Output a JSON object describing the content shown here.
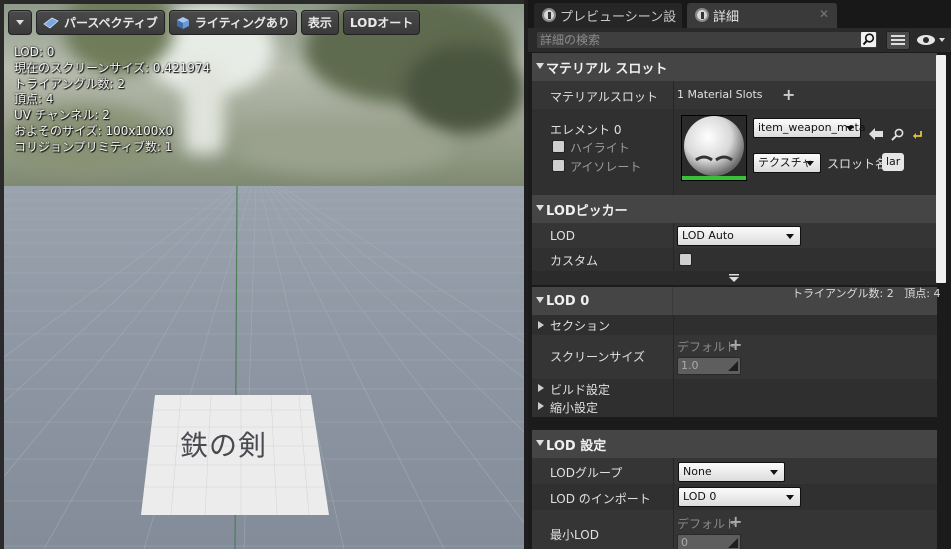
{
  "viewport": {
    "toolbar": {
      "perspective_label": "パースペクティブ",
      "lighting_label": "ライティングあり",
      "show_label": "表示",
      "lod_label": "LODオート"
    },
    "stats": [
      "LOD: 0",
      "現在のスクリーンサイズ: 0.421974",
      "トライアングル数: 2",
      "頂点: 4",
      "UV チャンネル: 2",
      "およそのサイズ: 100x100x0",
      "コリジョンプリミティブ数: 1"
    ],
    "card_text": "鉄の剣"
  },
  "details": {
    "tabs": [
      {
        "label": "プレビューシーン設"
      },
      {
        "label": "詳細"
      }
    ],
    "search_placeholder": "詳細の検索",
    "material_slots": {
      "title": "マテリアル スロット",
      "slots_label": "マテリアルスロット",
      "slots_value": "1 Material Slots",
      "element_label": "エレメント 0",
      "highlight_label": "ハイライト",
      "isolate_label": "アイソレート",
      "material_name": "item_weapon_meta",
      "texture_label": "テクスチャ",
      "slot_name_label": "スロット名",
      "slot_name_value": "lar"
    },
    "lod_picker": {
      "title": "LODピッカー",
      "lod_label": "LOD",
      "lod_value": "LOD Auto",
      "custom_label": "カスタム"
    },
    "lod0": {
      "title": "LOD 0",
      "info": "トライアングル数: 2   頂点: 4",
      "sections_label": "セクション",
      "default_label": "デフォルト",
      "screen_size_label": "スクリーンサイズ",
      "screen_size_value": "1.0",
      "build_settings_label": "ビルド設定",
      "reduction_settings_label": "縮小設定"
    },
    "lod_settings": {
      "title": "LOD 設定",
      "group_label": "LODグループ",
      "group_value": "None",
      "import_label": "LOD のインポート",
      "import_value": "LOD 0",
      "default_label": "デフォルト",
      "min_lod_label": "最小LOD",
      "min_lod_value": "0"
    }
  }
}
